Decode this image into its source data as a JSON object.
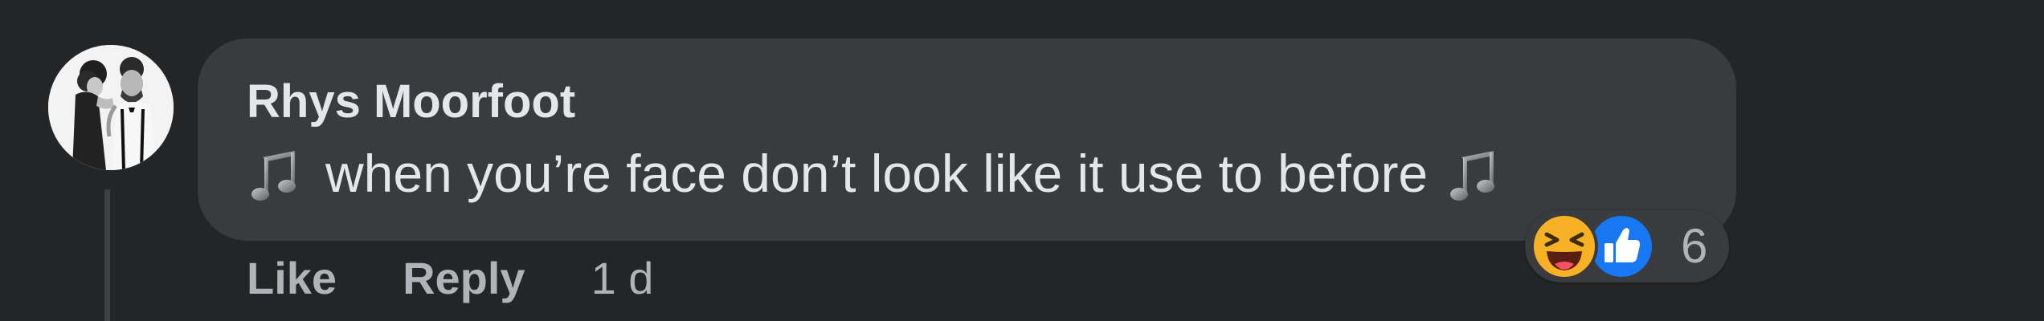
{
  "comment": {
    "author": "Rhys Moorfoot",
    "text": "when you’re face don’t look like it use to before",
    "leading_icon": "music-note-icon",
    "trailing_icon": "music-note-icon",
    "reactions": {
      "icons": [
        "haha-icon",
        "like-icon"
      ],
      "count": "6"
    },
    "actions": {
      "like_label": "Like",
      "reply_label": "Reply",
      "timestamp": "1 d"
    }
  },
  "colors": {
    "background": "#242526",
    "bubble": "#3a3b3c",
    "primary_text": "#e4e6eb",
    "secondary_text": "#b0b3b8",
    "like_blue": "#1877f2",
    "haha_yellow": "#f7b125"
  }
}
